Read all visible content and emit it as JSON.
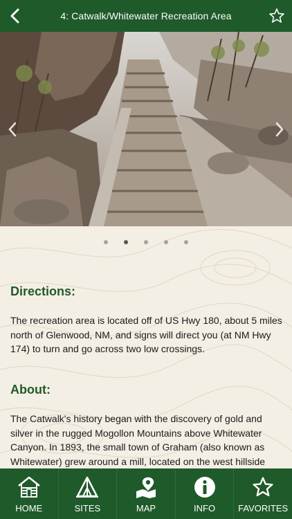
{
  "header": {
    "title": "4: Catwalk/Whitewater Recreation Area"
  },
  "carousel": {
    "dot_count": 5,
    "active_index": 1
  },
  "directions": {
    "title": "Directions:",
    "text": "The recreation area is located off of US Hwy 180, about 5 miles north of Glenwood, NM, and signs will direct you (at NM Hwy 174) to turn and go across two low crossings."
  },
  "about": {
    "title": "About:",
    "text": "The Catwalk's history began with the discovery of gold and silver in the rugged Mogollon Mountains above Whitewater Canyon. In 1893, the small town of Graham (also known as Whitewater) grew around a mill, located on the west hillside"
  },
  "tabs": [
    {
      "label": "HOME",
      "icon": "cabin-icon"
    },
    {
      "label": "SITES",
      "icon": "tent-icon"
    },
    {
      "label": "MAP",
      "icon": "map-pin-icon"
    },
    {
      "label": "INFO",
      "icon": "info-icon"
    },
    {
      "label": "FAVORITES",
      "icon": "star-icon"
    }
  ],
  "colors": {
    "brand_green": "#1f5a2a",
    "background": "#f4efe5"
  }
}
